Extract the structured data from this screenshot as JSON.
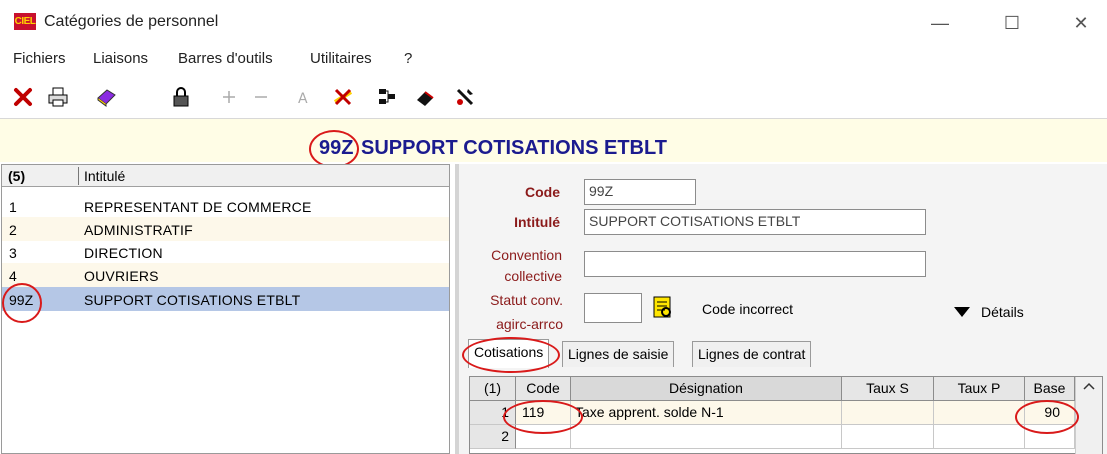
{
  "window": {
    "title": "Catégories de personnel",
    "app_icon_text": "CIEL",
    "minimize": "—",
    "maximize": "☐",
    "close": "✕"
  },
  "menu": [
    "Fichiers",
    "Liaisons",
    "Barres d'outils",
    "Utilitaires",
    "?"
  ],
  "toolbar_icons": [
    "close-icon",
    "print-icon",
    "book-icon",
    "lock-icon",
    "add-icon",
    "remove-icon",
    "text-style-icon",
    "cancel-icon",
    "tree-icon",
    "eraser-icon",
    "tools-icon"
  ],
  "header": {
    "code": "99Z",
    "title": "SUPPORT COTISATIONS ETBLT"
  },
  "list": {
    "count_label": "(5)",
    "column_label": "Intitulé",
    "rows": [
      {
        "code": "1",
        "label": "REPRESENTANT DE COMMERCE"
      },
      {
        "code": "2",
        "label": "ADMINISTRATIF"
      },
      {
        "code": "3",
        "label": "DIRECTION"
      },
      {
        "code": "4",
        "label": "OUVRIERS"
      },
      {
        "code": "99Z",
        "label": "SUPPORT COTISATIONS ETBLT"
      }
    ]
  },
  "form": {
    "code_label": "Code",
    "code_value": "99Z",
    "intitule_label": "Intitulé",
    "intitule_value": "SUPPORT COTISATIONS ETBLT",
    "convention_label_1": "Convention",
    "convention_label_2": "collective",
    "convention_value": "",
    "statut_label_1": "Statut conv.",
    "statut_label_2": "agirc-arrco",
    "statut_value": "",
    "code_incorrect": "Code incorrect",
    "details_label": "Détails"
  },
  "tabs": [
    "Cotisations",
    "Lignes de saisie",
    "Lignes de contrat"
  ],
  "grid": {
    "headers": {
      "count": "(1)",
      "code": "Code",
      "designation": "Désignation",
      "taux_s": "Taux S",
      "taux_p": "Taux P",
      "base": "Base"
    },
    "rows": [
      {
        "num": "1",
        "code": "119",
        "designation": "Taxe apprent. solde N-1",
        "taux_s": "",
        "taux_p": "",
        "base": "90"
      },
      {
        "num": "2",
        "code": "",
        "designation": "",
        "taux_s": "",
        "taux_p": "",
        "base": ""
      }
    ]
  },
  "colors": {
    "header_bg": "#fffde6",
    "header_text": "#1b1b8f",
    "selection": "#b5c7e6",
    "annotation": "#d91a1a",
    "label_red": "#8b1a1a"
  }
}
